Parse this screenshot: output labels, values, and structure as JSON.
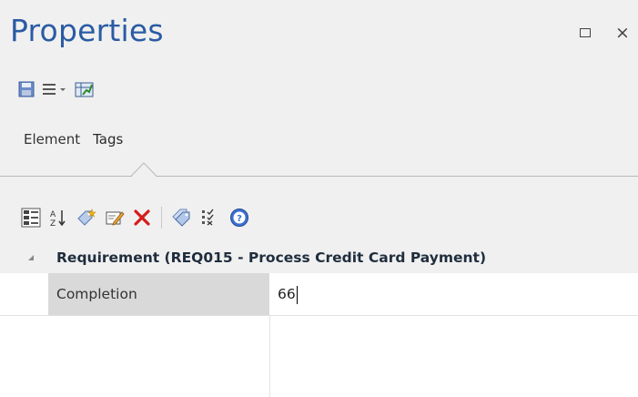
{
  "window": {
    "title": "Properties",
    "maximize_glyph": "",
    "close_glyph": "×"
  },
  "toolbar_top": {
    "items": [
      {
        "name": "save-icon"
      },
      {
        "name": "menu-icon"
      },
      {
        "name": "chart-icon"
      }
    ]
  },
  "tabs": [
    {
      "label": "Element",
      "active": false
    },
    {
      "label": "Tags",
      "active": true
    }
  ],
  "toolbar_tags": {
    "items": [
      {
        "name": "categorized-view-icon"
      },
      {
        "name": "sort-alphabetical-icon"
      },
      {
        "name": "new-tag-icon"
      },
      {
        "name": "edit-tag-icon"
      },
      {
        "name": "delete-tag-icon"
      },
      {
        "name": "tag-values-icon"
      },
      {
        "name": "checklist-icon"
      },
      {
        "name": "help-icon"
      }
    ]
  },
  "group": {
    "label": "Requirement (REQ015 - Process Credit Card Payment)"
  },
  "properties": [
    {
      "name": "Completion",
      "value": "66"
    }
  ],
  "colors": {
    "title": "#2a5ba3",
    "delete": "#d61b1b",
    "help": "#3b6fd1"
  }
}
